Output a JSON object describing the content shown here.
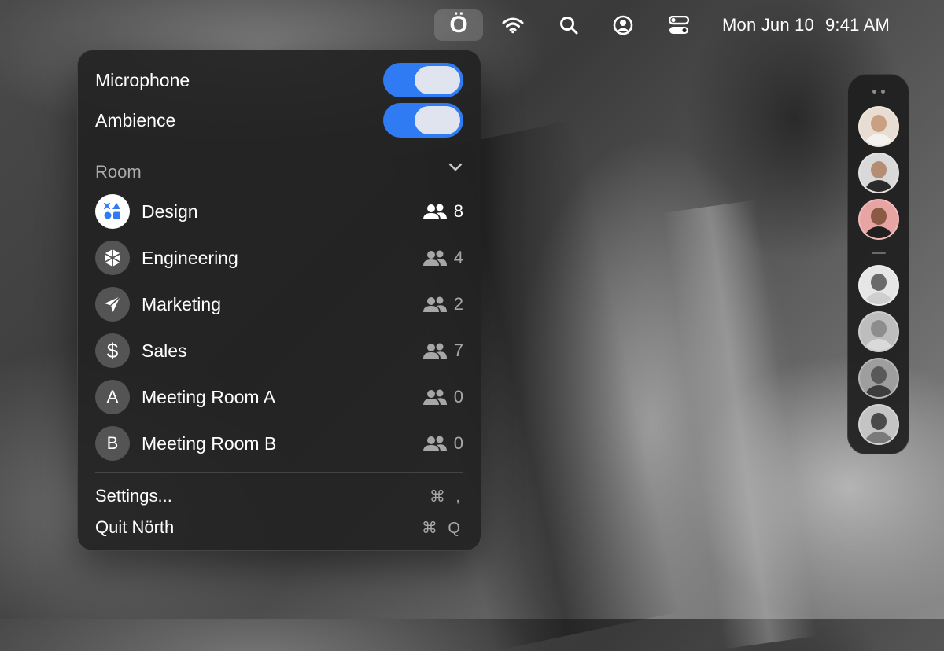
{
  "menubar": {
    "app_icon": "Ö",
    "icons": [
      "wifi-icon",
      "search-icon",
      "user-circle-icon",
      "control-center-icon"
    ],
    "clock": {
      "date": "Mon Jun 10",
      "time": "9:41 AM"
    }
  },
  "menu": {
    "toggles": [
      {
        "label": "Microphone",
        "on": true
      },
      {
        "label": "Ambience",
        "on": true
      }
    ],
    "room_section_title": "Room",
    "rooms": [
      {
        "name": "Design",
        "icon": "design-shapes-icon",
        "glyph": "",
        "count": "8",
        "active": true
      },
      {
        "name": "Engineering",
        "icon": "cube-icon",
        "glyph": "",
        "count": "4",
        "active": false
      },
      {
        "name": "Marketing",
        "icon": "paper-plane-icon",
        "glyph": "",
        "count": "2",
        "active": false
      },
      {
        "name": "Sales",
        "icon": "dollar-icon",
        "glyph": "$",
        "count": "7",
        "active": false
      },
      {
        "name": "Meeting Room A",
        "icon": "letter-a-icon",
        "glyph": "A",
        "count": "0",
        "active": false
      },
      {
        "name": "Meeting Room B",
        "icon": "letter-b-icon",
        "glyph": "B",
        "count": "0",
        "active": false
      }
    ],
    "settings_label": "Settings...",
    "settings_shortcut": "⌘ ,",
    "quit_label": "Quit Nörth",
    "quit_shortcut": "⌘ Q"
  },
  "colors": {
    "accent": "#2f7bf4",
    "toggle_knob": "#dfe4ee",
    "panel": "#222121"
  }
}
